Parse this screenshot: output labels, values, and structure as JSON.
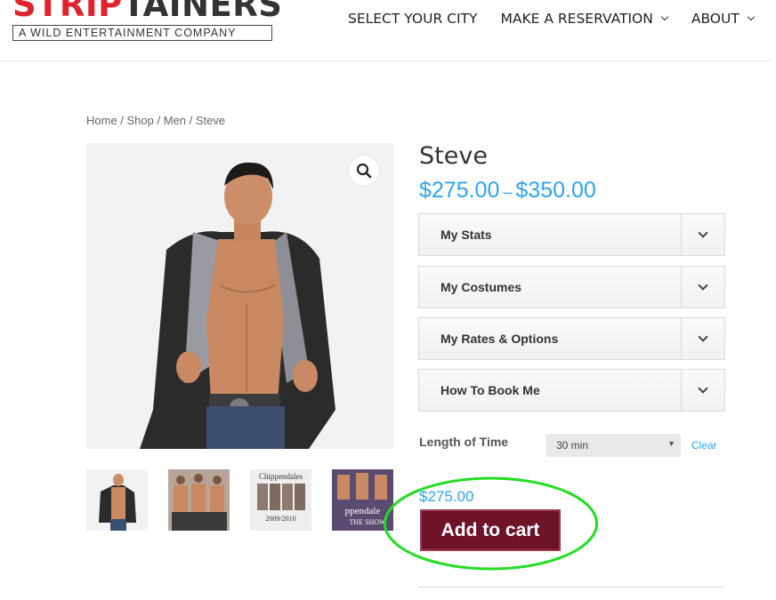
{
  "header": {
    "logo_strip": "STRIP",
    "logo_tainers": "TAINERS",
    "logo_tagline": "A WILD ENTERTAINMENT COMPANY",
    "nav": [
      {
        "label": "SELECT YOUR CITY",
        "has_dropdown": false
      },
      {
        "label": "MAKE A RESERVATION",
        "has_dropdown": true
      },
      {
        "label": "ABOUT",
        "has_dropdown": true
      }
    ]
  },
  "breadcrumb": "Home / Shop / Men / Steve",
  "product": {
    "title": "Steve",
    "price_min": "$275.00",
    "price_sep": "–",
    "price_max": "$350.00",
    "accordions": [
      {
        "label": "My Stats"
      },
      {
        "label": "My Costumes"
      },
      {
        "label": "My Rates & Options"
      },
      {
        "label": "How To Book Me"
      }
    ],
    "length_label": "Length of Time",
    "length_value": "30 min",
    "clear_label": "Clear",
    "variation_price": "$275.00",
    "add_to_cart_label": "Add to cart"
  },
  "gallery": {
    "thumb_captions": [
      "",
      "",
      "Chippendales 2009/2010",
      "Chippendales THE SHOW"
    ]
  },
  "colors": {
    "accent_blue": "#2ea3f2",
    "brand_red": "#e0242c",
    "cart_button": "#6e1329",
    "highlight_green": "#22dd22"
  }
}
